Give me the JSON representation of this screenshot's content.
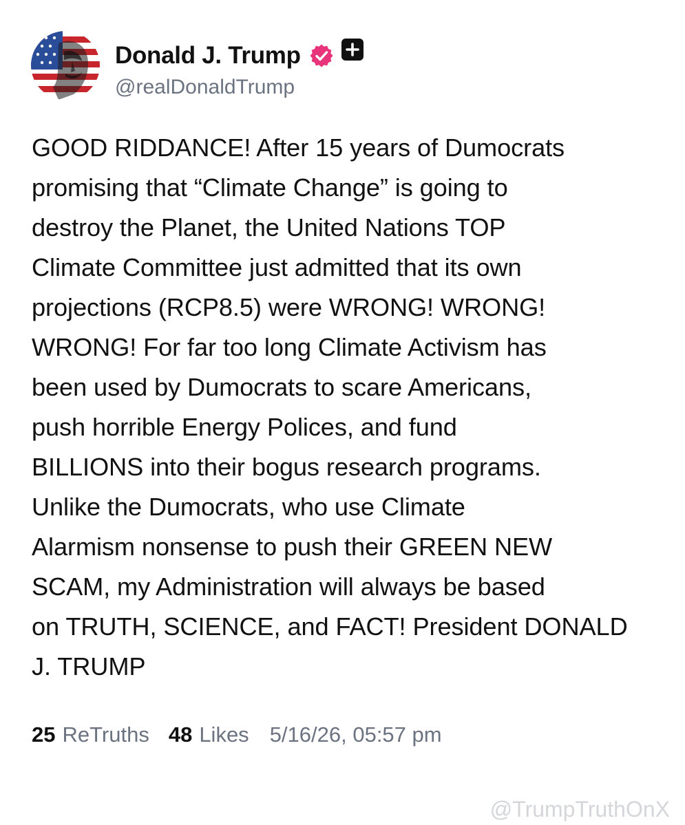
{
  "author": {
    "display_name": "Donald J. Trump",
    "handle": "@realDonaldTrump",
    "avatar_icon": "flag-face-avatar",
    "verified_icon": "verified-badge-icon",
    "verified_color": "#e8347a",
    "extra_icon": "plus-square-icon"
  },
  "post": {
    "text": "GOOD RIDDANCE! After 15 years of Dumocrats\npromising that “Climate Change” is going to\ndestroy the Planet, the United Nations TOP\nClimate Committee just admitted that its own\nprojections (RCP8.5) were WRONG! WRONG!\nWRONG! For far too long Climate Activism has\nbeen used by Dumocrats to scare Americans,\npush horrible Energy Polices, and fund\nBILLIONS into their bogus research programs.\nUnlike the Dumocrats, who use Climate\nAlarmism nonsense to push their GREEN NEW\nSCAM, my Administration will always be based\non TRUTH, SCIENCE, and FACT! President DONALD\nJ. TRUMP"
  },
  "stats": {
    "retruths_count": "25",
    "retruths_label": "ReTruths",
    "likes_count": "48",
    "likes_label": "Likes",
    "timestamp": "5/16/26, 05:57 pm"
  },
  "watermark": "@TrumpTruthOnX",
  "colors": {
    "text": "#111111",
    "muted": "#6b7280",
    "watermark": "#d4d6da",
    "background": "#ffffff"
  }
}
